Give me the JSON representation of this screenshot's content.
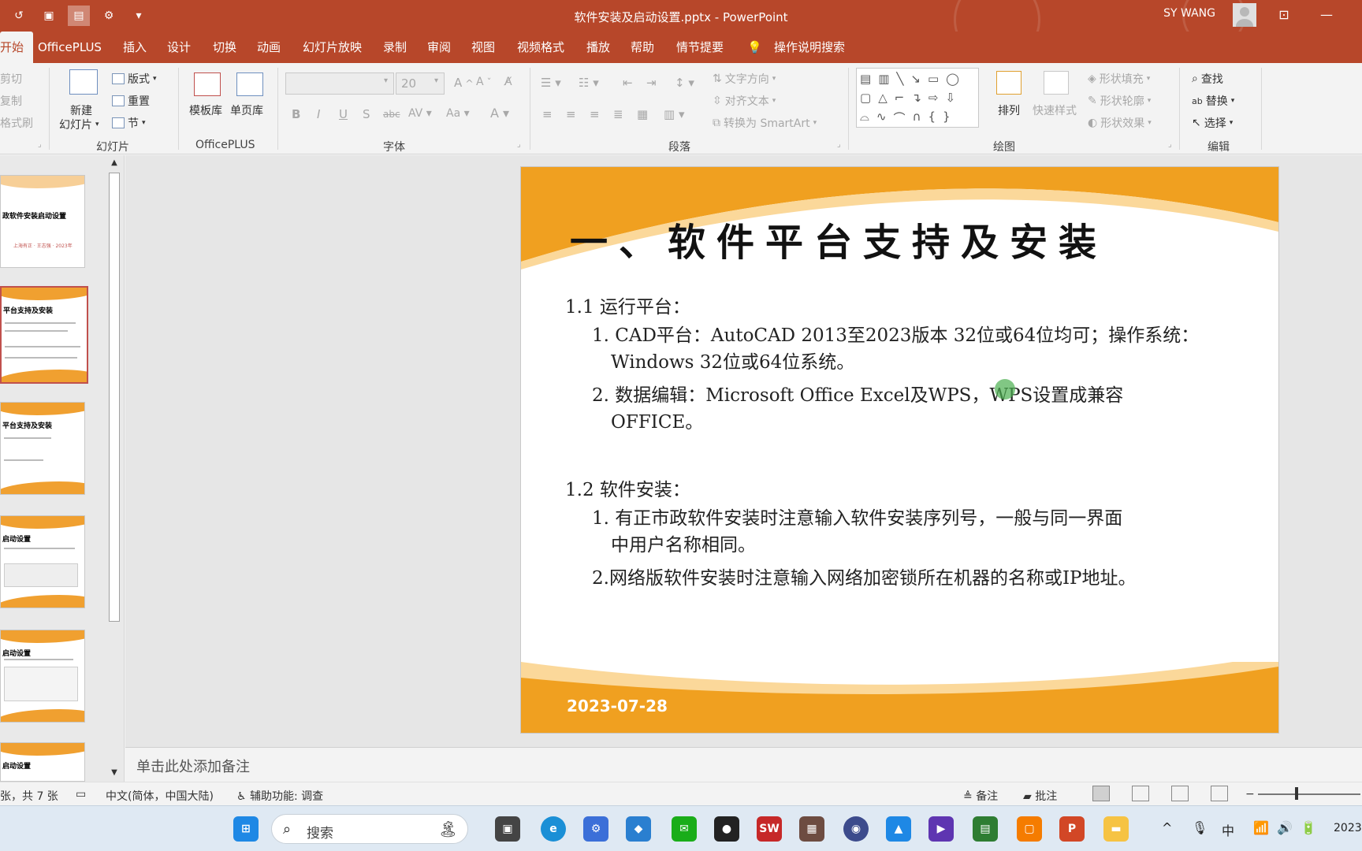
{
  "window": {
    "doc_title": "软件安装及启动设置.pptx  -  PowerPoint",
    "user_name": "SY WANG"
  },
  "tabs": [
    "开始",
    "OfficePLUS",
    "插入",
    "设计",
    "切换",
    "动画",
    "幻灯片放映",
    "录制",
    "审阅",
    "视图",
    "视频格式",
    "播放",
    "帮助",
    "情节提要"
  ],
  "tell_me": "操作说明搜索",
  "ribbon": {
    "clipboard": {
      "cut": "剪切",
      "copy": "复制",
      "format_painter": "格式刷"
    },
    "slides": {
      "new_slide_line1": "新建",
      "new_slide_line2": "幻灯片",
      "layout": "版式",
      "reset": "重置",
      "section": "节",
      "label": "幻灯片"
    },
    "officeplus": {
      "template": "模板库",
      "single_page": "单页库",
      "label": "OfficePLUS"
    },
    "font": {
      "size": "20",
      "label": "字体"
    },
    "paragraph": {
      "text_direction": "文字方向",
      "align_text": "对齐文本",
      "smartart": "转换为 SmartArt",
      "label": "段落"
    },
    "drawing": {
      "arrange": "排列",
      "quick_styles": "快速样式",
      "shape_fill": "形状填充",
      "shape_outline": "形状轮廓",
      "shape_effects": "形状效果",
      "label": "绘图"
    },
    "editing": {
      "find": "查找",
      "replace": "替换",
      "select": "选择",
      "label": "编辑"
    }
  },
  "thumbnails": [
    {
      "title": "政软件安装启动设置",
      "sub": "上海有正 · 王志强 · 2023年"
    },
    {
      "title": "平台支持及安装"
    },
    {
      "title": "平台支持及安装"
    },
    {
      "title": "启动设置"
    },
    {
      "title": "启动设置"
    },
    {
      "title": "启动设置"
    }
  ],
  "slide": {
    "title": "一、软件平台支持及安装",
    "s1_heading": "1.1 运行平台：",
    "s1_item1_line1": "1. CAD平台：AutoCAD 2013至2023版本 32位或64位均可；操作系统：",
    "s1_item1_line2": "Windows 32位或64位系统。",
    "s1_item2_line1": "2. 数据编辑：Microsoft Office Excel及WPS，WPS设置成兼容",
    "s1_item2_line2": "OFFICE。",
    "s2_heading": "1.2 软件安装：",
    "s2_item1_line1": "1. 有正市政软件安装时注意输入软件安装序列号，一般与同一界面",
    "s2_item1_line2": "中用户名称相同。",
    "s2_item2": "2.网络版软件安装时注意输入网络加密锁所在机器的名称或IP地址。",
    "date": "2023-07-28",
    "band_color": "#f0a020"
  },
  "notes_placeholder": "单击此处添加备注",
  "status": {
    "slide_count": "张，共 7 张",
    "language": "中文(简体，中国大陆)",
    "accessibility": "辅助功能: 调查",
    "notes": "备注",
    "comments": "批注"
  },
  "taskbar": {
    "search_placeholder": "搜索",
    "ime": "中",
    "clock": "2023-"
  }
}
